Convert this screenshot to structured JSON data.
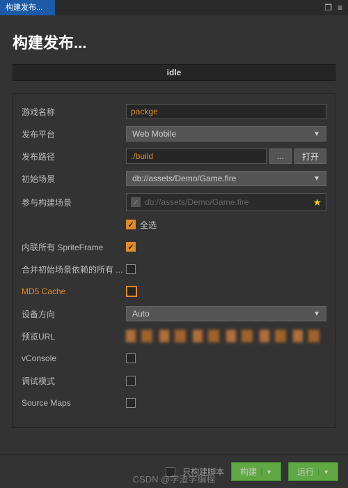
{
  "titlebar": {
    "tab": "构建发布..."
  },
  "title": "构建发布...",
  "status": "idle",
  "form": {
    "gameName": {
      "label": "游戏名称",
      "value": "packge"
    },
    "platform": {
      "label": "发布平台",
      "value": "Web Mobile"
    },
    "path": {
      "label": "发布路径",
      "value": "./build",
      "browse": "...",
      "open": "打开"
    },
    "startScene": {
      "label": "初始场景",
      "value": "db://assets/Demo/Game.fire"
    },
    "includeScenes": {
      "label": "参与构建场景",
      "item": "db://assets/Demo/Game.fire",
      "selectAll": "全选"
    },
    "inlineSprite": {
      "label": "内联所有 SpriteFrame"
    },
    "mergeDeps": {
      "label": "合并初始场景依赖的所有 ..."
    },
    "md5": {
      "label": "MD5 Cache"
    },
    "orientation": {
      "label": "设备方向",
      "value": "Auto"
    },
    "previewUrl": {
      "label": "预览URL"
    },
    "vconsole": {
      "label": "vConsole"
    },
    "debug": {
      "label": "调试模式"
    },
    "sourceMaps": {
      "label": "Source Maps"
    }
  },
  "footer": {
    "scriptOnly": "只构建脚本",
    "build": "构建",
    "run": "运行"
  },
  "watermark": "CSDN @学渣学编程"
}
